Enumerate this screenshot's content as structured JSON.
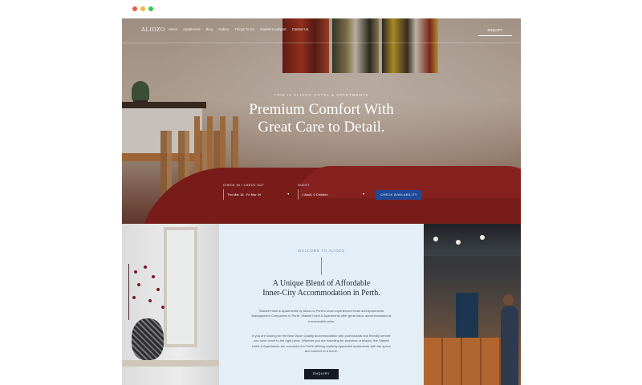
{
  "window": {
    "dots": [
      "#ee5a52",
      "#f4b73c",
      "#3dc454"
    ]
  },
  "nav": {
    "logo": "ALIOZO",
    "items": [
      "Home",
      "Apartments",
      "Blog",
      "Gallery",
      "Things To Do",
      "Stawell Southport",
      "Contact Us"
    ],
    "enquiry": "ENQUIRY"
  },
  "hero": {
    "eyebrow": "THIS IS ALIOZO HOTEL & APARTMENTS",
    "title_line1": "Premium Comfort With",
    "title_line2": "Great Care to Detail."
  },
  "booking": {
    "dates_label": "CHECK IN / CHECK OUT",
    "dates_value": "Thu Mar 18 - Fri Mar 29",
    "guests_label": "GUEST",
    "guests_value": "1 Adult, 0 Children",
    "button": "CHECK AVAILABILITY"
  },
  "intro": {
    "eyebrow": "WELCOME TO ALIOZO",
    "title_line1": "A Unique Blend of Affordable",
    "title_line2": "Inner-City Accommodation in Perth.",
    "para1": "Stawell Hotel & Apartments by Aliozo is Perth's most experienced Hotel and Apartments Management Companies in Perth. Stawell Hotel & Apartments offer great value accommodation at a reasonable price.",
    "para2": "If you are looking for the Best Value Quality accommodation with professional and friendly service you have come to the right place. Whether you are travelling for business or leisure, the Stawell Hotel & Apartments are convenient to Perth offering stylishly appointed apartments with the space and comfort of a home.",
    "button": "ENQUIRY"
  }
}
